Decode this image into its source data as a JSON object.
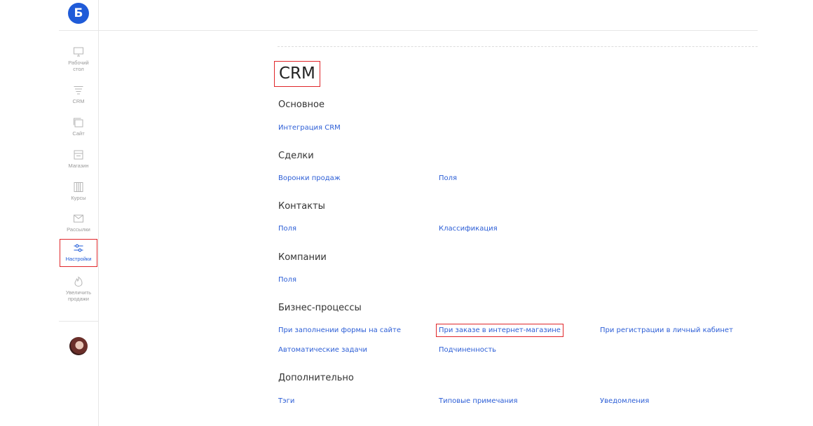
{
  "sidebar": {
    "logo": "Б",
    "items": [
      {
        "label": "Рабочий стол",
        "icon": "monitor-icon"
      },
      {
        "label": "CRM",
        "icon": "funnel-icon"
      },
      {
        "label": "Сайт",
        "icon": "site-icon"
      },
      {
        "label": "Магазин",
        "icon": "store-icon"
      },
      {
        "label": "Курсы",
        "icon": "courses-icon"
      },
      {
        "label": "Рассылки",
        "icon": "envelope-icon"
      },
      {
        "label": "Настройки",
        "icon": "sliders-icon",
        "active": true
      },
      {
        "label": "Увеличить продажи",
        "icon": "flame-icon"
      }
    ],
    "accent_color": "#1f5bd8",
    "highlight_color": "#e0262a"
  },
  "main": {
    "title": "CRM",
    "sections": [
      {
        "title": "Основное",
        "links": [
          "Интеграция CRM"
        ]
      },
      {
        "title": "Сделки",
        "links": [
          "Воронки продаж",
          "Поля"
        ]
      },
      {
        "title": "Контакты",
        "links": [
          "Поля",
          "Классификация"
        ]
      },
      {
        "title": "Компании",
        "links": [
          "Поля"
        ]
      },
      {
        "title": "Бизнес-процессы",
        "links": [
          "При заполнении формы на сайте",
          "При заказе в интернет-магазине",
          "При регистрации в личный кабинет",
          "Автоматические задачи",
          "Подчиненность"
        ]
      },
      {
        "title": "Дополнительно",
        "links": [
          "Тэги",
          "Типовые примечания",
          "Уведомления"
        ]
      }
    ]
  }
}
